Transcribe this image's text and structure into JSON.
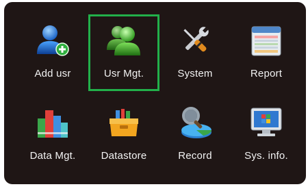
{
  "menu": {
    "items": [
      {
        "label": "Add usr",
        "icon": "add-user-icon"
      },
      {
        "label": "Usr Mgt.",
        "icon": "users-icon",
        "selected": true
      },
      {
        "label": "System",
        "icon": "tools-icon"
      },
      {
        "label": "Report",
        "icon": "report-icon"
      },
      {
        "label": "Data Mgt.",
        "icon": "bar-chart-icon"
      },
      {
        "label": "Datastore",
        "icon": "toolbox-icon"
      },
      {
        "label": "Record",
        "icon": "record-search-icon"
      },
      {
        "label": "Sys. info.",
        "icon": "monitor-icon"
      }
    ]
  },
  "colors": {
    "background": "#1f1615",
    "selection_border": "#22b04a",
    "label_text": "#f2f2f2"
  }
}
